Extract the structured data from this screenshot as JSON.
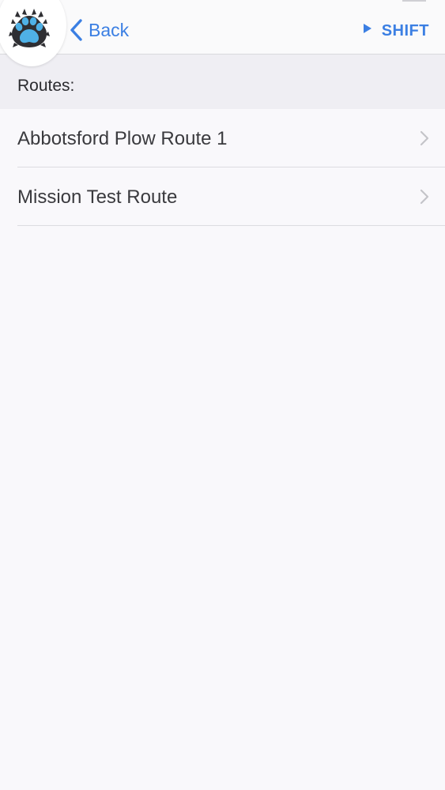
{
  "nav": {
    "logo": "bear-paw-logo",
    "back_label": "Back",
    "back_icon": "chevron-left-icon",
    "shift_label": "SHIFT",
    "shift_icon": "play-icon",
    "accent_color": "#3b7fe3"
  },
  "section": {
    "title": "Routes:"
  },
  "routes": [
    {
      "label": "Abbotsford Plow Route 1",
      "icon": "chevron-right-icon"
    },
    {
      "label": "Mission Test Route",
      "icon": "chevron-right-icon"
    }
  ]
}
